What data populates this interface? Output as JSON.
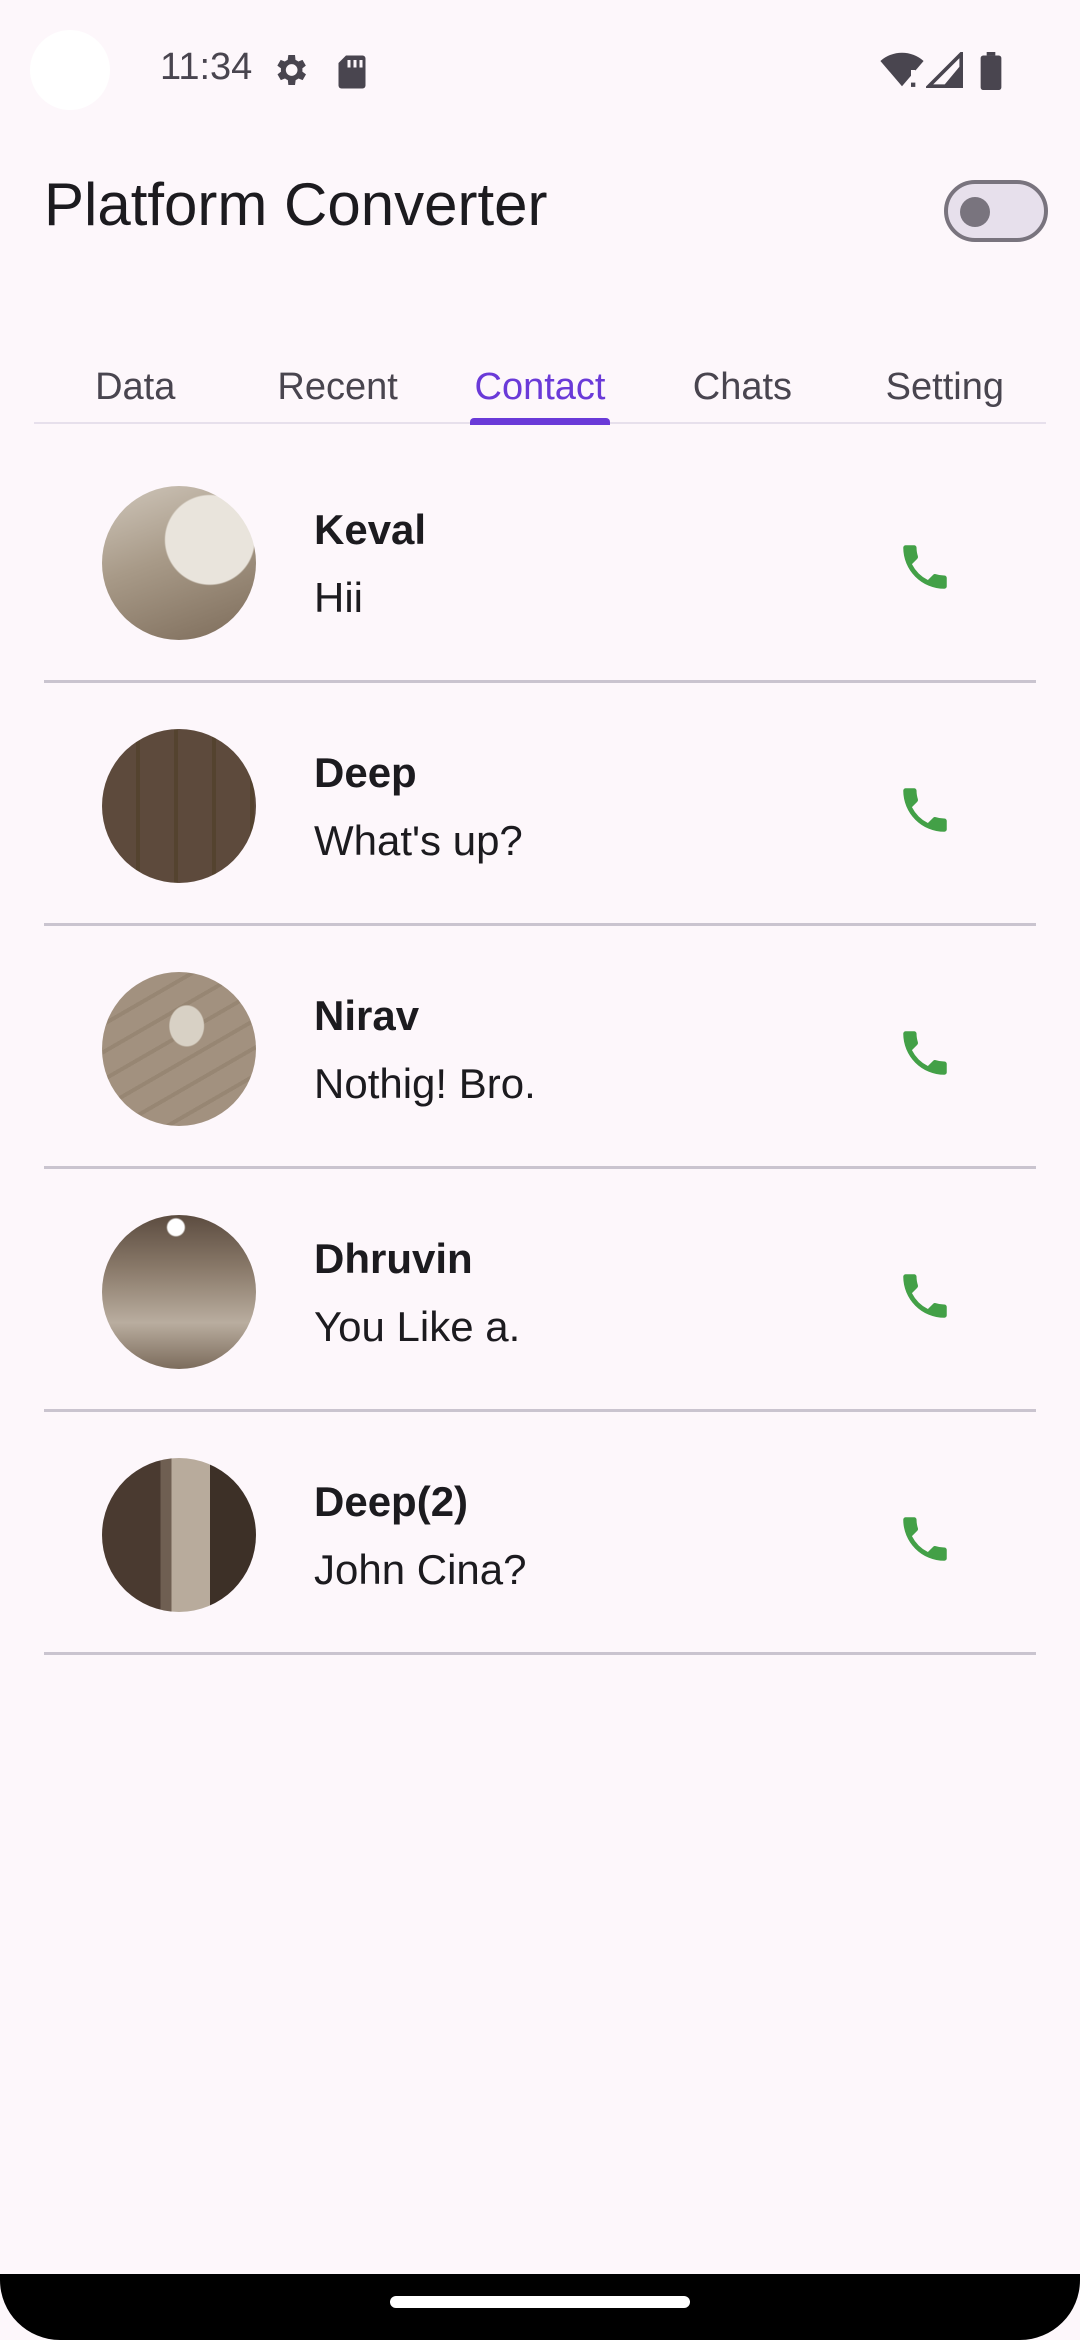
{
  "status_bar": {
    "time": "11:34",
    "icons": [
      "settings-gear-icon",
      "sd-card-icon",
      "wifi-icon",
      "cell-signal-icon",
      "battery-icon"
    ]
  },
  "app_bar": {
    "title": "Platform Converter",
    "theme_toggle_on": false
  },
  "tabs": [
    {
      "label": "Data",
      "active": false
    },
    {
      "label": "Recent",
      "active": false
    },
    {
      "label": "Contact",
      "active": true
    },
    {
      "label": "Chats",
      "active": false
    },
    {
      "label": "Setting",
      "active": false
    }
  ],
  "contacts": [
    {
      "name": "Keval",
      "message": "Hii"
    },
    {
      "name": "Deep",
      "message": "What's up?"
    },
    {
      "name": "Nirav",
      "message": "Nothig! Bro."
    },
    {
      "name": "Dhruvin",
      "message": "You Like a."
    },
    {
      "name": "Deep(2)",
      "message": "John Cina?"
    }
  ],
  "colors": {
    "background": "#fdf7fb",
    "accent": "#6a3ad8",
    "call_icon": "#43a047",
    "divider": "#cac4cf"
  }
}
